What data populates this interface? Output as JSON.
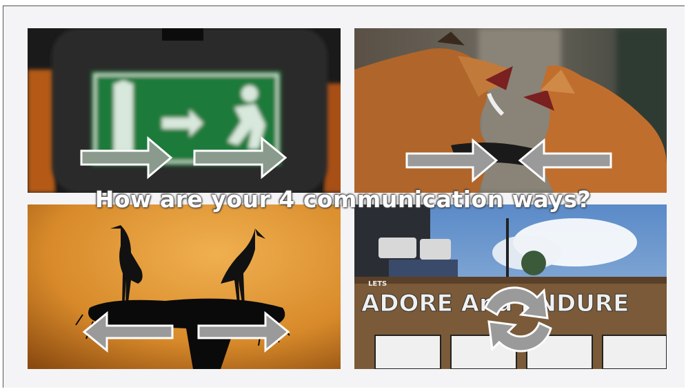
{
  "title": "How are your 4 communication ways?",
  "tiles": [
    {
      "scene": "exit-sign",
      "arrows": "right-right"
    },
    {
      "scene": "fighting-foxes",
      "arrows": "converging"
    },
    {
      "scene": "storks-on-nest",
      "arrows": "diverging"
    },
    {
      "scene": "graffiti-building",
      "wall_text_1": "LETS",
      "wall_text_2": "ADORE And ENDURE",
      "arrows": "cycle"
    }
  ],
  "colors": {
    "arrow_fill": "#8a9a8c",
    "arrow_stroke": "#ffffff",
    "sunset": "#e49a38",
    "exit_green": "#1f7a3b"
  }
}
